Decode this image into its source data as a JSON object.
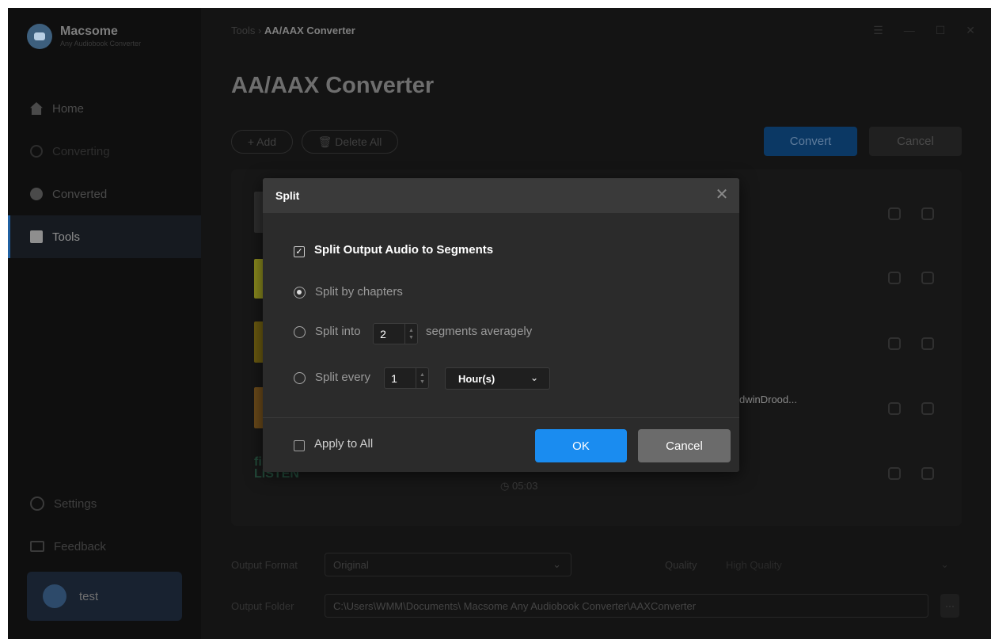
{
  "app": {
    "name": "Macsome",
    "subtitle": "Any Audiobook Converter",
    "accent_color": "#1a8cf0"
  },
  "sidebar": {
    "items": [
      {
        "label": "Home",
        "icon": "home-icon"
      },
      {
        "label": "Converting",
        "icon": "converting-icon"
      },
      {
        "label": "Converted",
        "icon": "clock-icon"
      },
      {
        "label": "Tools",
        "icon": "toolbox-icon",
        "active": true
      }
    ],
    "settings_label": "Settings",
    "feedback_label": "Feedback",
    "user_name": "test"
  },
  "header": {
    "breadcrumb_parent": "Tools",
    "breadcrumb_sep": "›",
    "breadcrumb_current": "AA/AAX Converter",
    "window_controls": [
      "menu-icon",
      "minimize-icon",
      "maximize-icon",
      "close-icon"
    ]
  },
  "main": {
    "page_title": "AA/AAX Converter",
    "add_label": "+ Add",
    "delete_all_label": "🗑 Delete All",
    "convert_label": "Convert",
    "cancel_label": "Cancel",
    "list": {
      "partial_title": "dwinDrood...",
      "last_item_cover_text": "first\nLISTEN",
      "duration": "05:03"
    },
    "output_format_label": "Output Format",
    "output_format_value": "Original",
    "quality_label": "Quality",
    "quality_value": "High Quality",
    "output_folder_label": "Output Folder",
    "output_folder_value": "C:\\Users\\WMM\\Documents\\ Macsome Any Audiobook Converter\\AAXConverter",
    "more_label": "···"
  },
  "dialog": {
    "title": "Split",
    "close_glyph": "✕",
    "split_output_label": "Split Output Audio to Segments",
    "split_output_checked": true,
    "option_chapters_label": "Split by chapters",
    "option_into_prefix": "Split into",
    "option_into_value": "2",
    "option_into_suffix": "segments averagely",
    "option_every_prefix": "Split every",
    "option_every_value": "1",
    "option_every_unit": "Hour(s)",
    "selected_option": "chapters",
    "apply_to_all_label": "Apply to All",
    "apply_to_all_checked": false,
    "ok_label": "OK",
    "cancel_label": "Cancel"
  }
}
